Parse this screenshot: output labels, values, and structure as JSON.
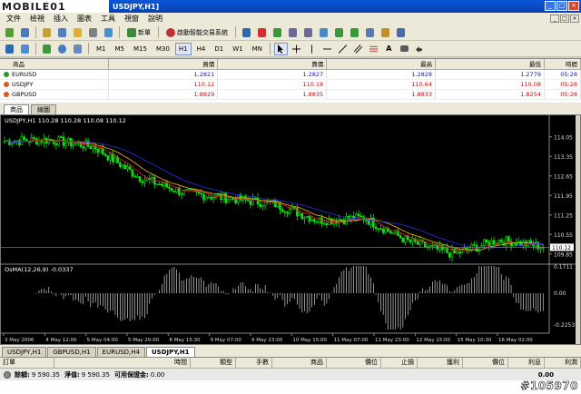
{
  "app": {
    "logo_text": "MOBILE01",
    "window_title": "USDJPY,H1]",
    "window_buttons": [
      "_",
      "□",
      "×"
    ]
  },
  "menu": {
    "items": [
      "文件",
      "檢視",
      "插入",
      "圖表",
      "工具",
      "視窗",
      "說明"
    ]
  },
  "toolbar1": {
    "new_order_label": "新單",
    "expert_label": "啟動智能交易系統"
  },
  "toolbar2": {
    "timeframes": [
      "M1",
      "M5",
      "M15",
      "M30",
      "H1",
      "H4",
      "D1",
      "W1",
      "MN"
    ],
    "active_timeframe": "H1"
  },
  "market_watch": {
    "columns": [
      "商品",
      "買價",
      "賣價",
      "最高",
      "最低",
      "時間"
    ],
    "rows": [
      {
        "symbol": "EURUSD",
        "bid": "1.2821",
        "ask": "1.2827",
        "high": "1.2828",
        "low": "1.2779",
        "time": "05:28",
        "color": "#1a1aa8",
        "dot": "#2a9a2a"
      },
      {
        "symbol": "USDJPY",
        "bid": "110.12",
        "ask": "110.18",
        "high": "110.64",
        "low": "110.08",
        "time": "05:28",
        "color": "#c01010",
        "dot": "#d06020"
      },
      {
        "symbol": "GBPUSD",
        "bid": "1.8829",
        "ask": "1.8835",
        "high": "1.8833",
        "low": "1.8254",
        "time": "05:28",
        "color": "#c01010",
        "dot": "#d06020"
      }
    ],
    "tabs": [
      "商品",
      "線圖"
    ],
    "active_tab": "商品"
  },
  "chart": {
    "header": "USDJPY,H1  110.28  110.28  110.08  110.12",
    "osma_header": "OsMA(12,26,9) -0.0337",
    "last_price_label": "110.12",
    "price_axis": [
      "114.05",
      "113.35",
      "112.65",
      "111.95",
      "111.25",
      "110.55",
      "110.12",
      "109.85"
    ],
    "osma_axis": [
      "0.1711",
      "0.00",
      "-0.2253"
    ],
    "time_axis": [
      "3 May 2006",
      "4 May 12:00",
      "5 May 04:00",
      "5 May 20:00",
      "8 May 15:30",
      "9 May 07:00",
      "9 May 23:00",
      "10 May 15:00",
      "11 May 07:00",
      "11 May 23:00",
      "12 May 15:00",
      "15 May 10:30",
      "16 May 02:00"
    ],
    "colors": {
      "bull": "#11dd11",
      "bear": "#11dd11",
      "ma_red": "#d02020",
      "ma_orange": "#e8a020",
      "ma_blue": "#2828d0",
      "osma": "#d0d0d0",
      "grid": "#444444"
    }
  },
  "chart_data": {
    "type": "line",
    "title": "USDJPY,H1",
    "xlabel": "",
    "ylabel": "",
    "ylim": [
      109.55,
      114.5
    ],
    "x": [
      "3 May 2006",
      "4 May 12:00",
      "5 May 04:00",
      "5 May 20:00",
      "8 May 15:30",
      "9 May 07:00",
      "9 May 23:00",
      "10 May 15:00",
      "11 May 07:00",
      "11 May 23:00",
      "12 May 15:00",
      "15 May 10:30",
      "16 May 02:00"
    ],
    "series": [
      {
        "name": "USDJPY",
        "values": [
          113.9,
          113.95,
          113.7,
          112.6,
          112.05,
          111.85,
          111.65,
          111.05,
          111.15,
          110.3,
          109.85,
          110.35,
          110.12
        ]
      }
    ]
  },
  "chart_tabs": {
    "items": [
      "USDJPY,H1",
      "GBPUSD,H1",
      "EURUSD,H4",
      "USDJPY,H1"
    ],
    "active_index": 3
  },
  "terminal": {
    "columns": [
      "訂單",
      "時間",
      "類型",
      "手數",
      "商品",
      "價位",
      "止損",
      "獲利",
      "價位",
      "利息",
      "利潤"
    ],
    "balance_label": "餘額:",
    "balance_value": "9 590.35",
    "equity_label": "淨值:",
    "equity_value": "9 590.35",
    "free_margin_label": "可用保證金:",
    "free_margin_value": "0.00",
    "profit_value": "0.00"
  },
  "watermark": "#105970"
}
